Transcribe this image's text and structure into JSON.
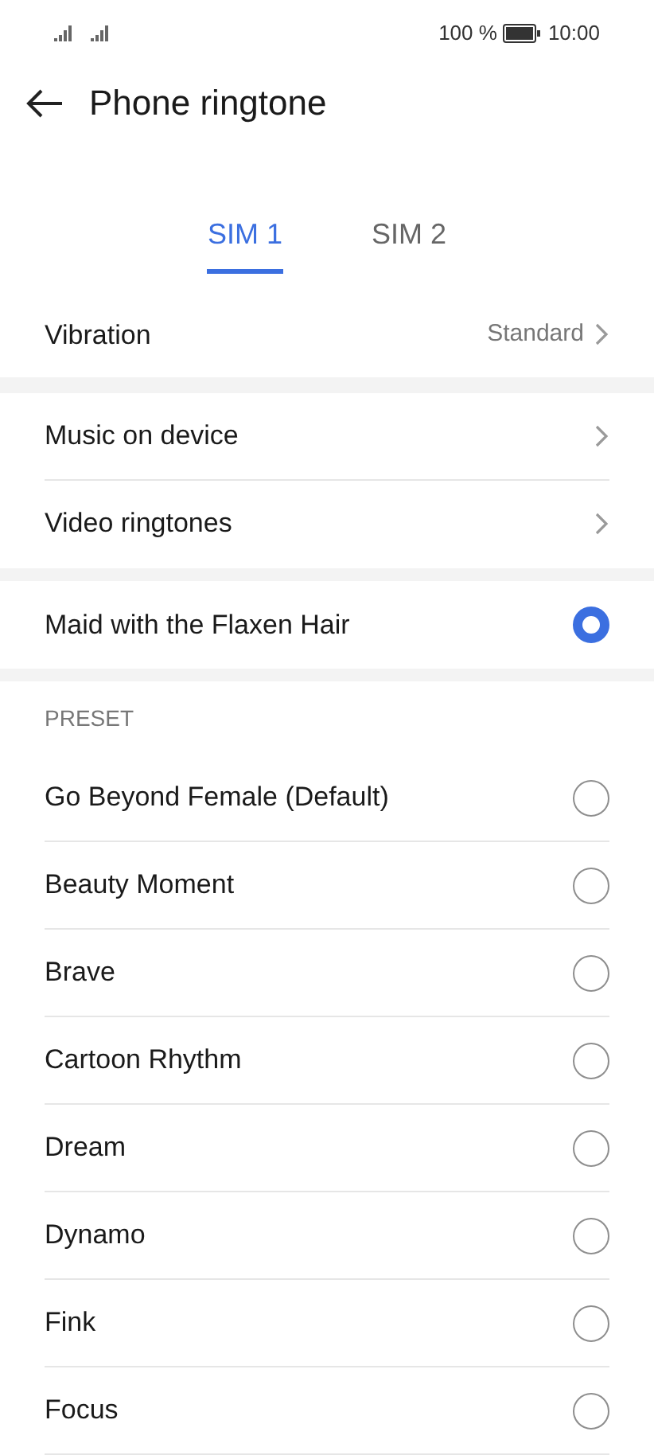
{
  "status_bar": {
    "battery_text": "100 %",
    "time": "10:00"
  },
  "header": {
    "title": "Phone ringtone"
  },
  "tabs": [
    {
      "label": "SIM 1",
      "selected": true
    },
    {
      "label": "SIM 2",
      "selected": false
    }
  ],
  "vibration": {
    "label": "Vibration",
    "value": "Standard"
  },
  "links": [
    {
      "label": "Music on device"
    },
    {
      "label": "Video ringtones"
    }
  ],
  "current": {
    "label": "Maid with the Flaxen Hair",
    "selected": true
  },
  "preset": {
    "heading": "PRESET",
    "items": [
      {
        "label": "Go Beyond Female (Default)",
        "selected": false
      },
      {
        "label": "Beauty Moment",
        "selected": false
      },
      {
        "label": "Brave",
        "selected": false
      },
      {
        "label": "Cartoon Rhythm",
        "selected": false
      },
      {
        "label": "Dream",
        "selected": false
      },
      {
        "label": "Dynamo",
        "selected": false
      },
      {
        "label": "Fink",
        "selected": false
      },
      {
        "label": "Focus",
        "selected": false
      }
    ]
  }
}
